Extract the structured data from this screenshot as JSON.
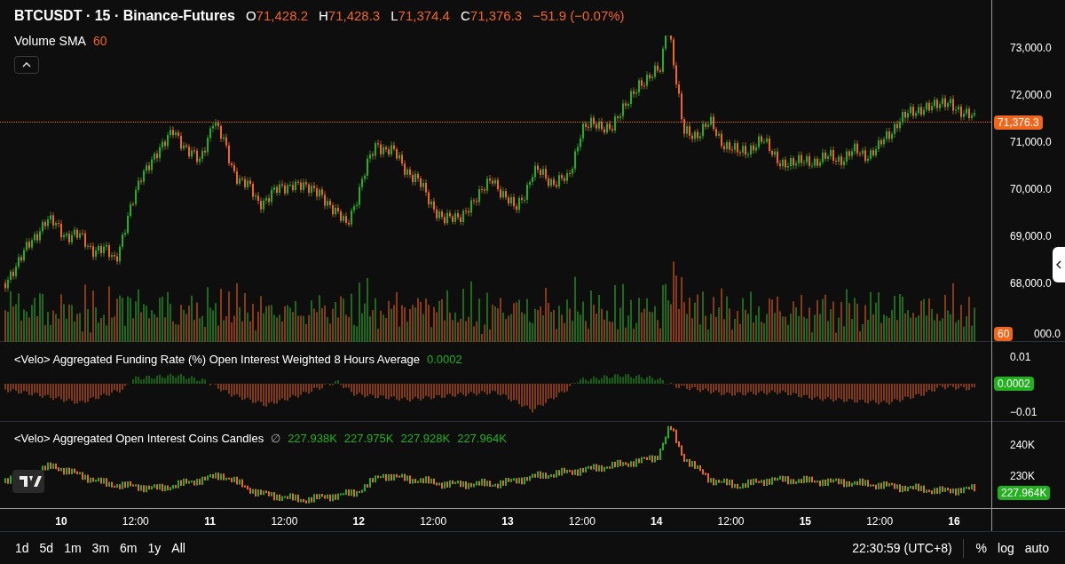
{
  "legend": {
    "symbol": "BTCUSDT · 15 · Binance-Futures",
    "ohlc": [
      {
        "label": "O",
        "value": "71,428.2"
      },
      {
        "label": "H",
        "value": "71,428.3"
      },
      {
        "label": "L",
        "value": "71,374.4"
      },
      {
        "label": "C",
        "value": "71,376.3"
      }
    ],
    "change": "−51.9 (−0.07%)"
  },
  "volume": {
    "name": "Volume SMA",
    "value": "60"
  },
  "price_axis": {
    "ticks": [
      "73,000.0",
      "72,000.0",
      "71,000.0",
      "70,000.0",
      "69,000.0",
      "68,000.0",
      "000.0"
    ],
    "last_price": "71,376.3",
    "volume_badge": "60"
  },
  "funding": {
    "title": "<Velo> Aggregated Funding Rate (%) Open Interest Weighted 8 Hours Average",
    "value": "0.0002",
    "ticks": [
      "0.01",
      "−0.01"
    ],
    "badge": "0.0002"
  },
  "open_interest": {
    "title": "<Velo> Aggregated Open Interest Coins Candles",
    "symbol": "∅",
    "values": [
      "227.938K",
      "227.975K",
      "227.928K",
      "227.964K"
    ],
    "ticks": [
      "240K",
      "230K"
    ],
    "badge": "227.964K"
  },
  "time_axis": [
    "10",
    "12:00",
    "11",
    "12:00",
    "12",
    "12:00",
    "13",
    "12:00",
    "14",
    "12:00",
    "15",
    "12:00",
    "16"
  ],
  "ranges": [
    "1d",
    "5d",
    "1m",
    "3m",
    "6m",
    "1y",
    "All"
  ],
  "clock": "22:30:59 (UTC+8)",
  "scale_options": [
    "%",
    "log",
    "auto"
  ]
}
